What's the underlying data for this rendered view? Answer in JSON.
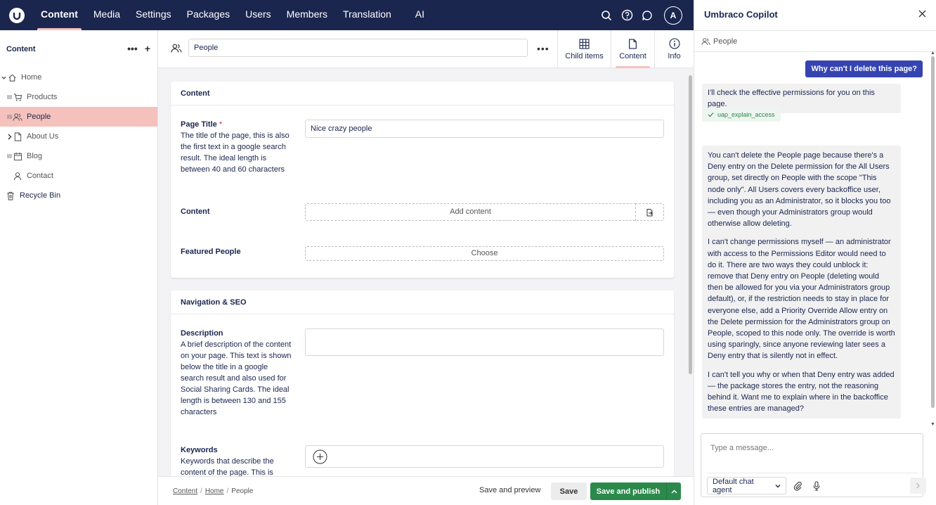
{
  "topnav": {
    "items": [
      {
        "label": "Content",
        "active": true
      },
      {
        "label": "Media"
      },
      {
        "label": "Settings"
      },
      {
        "label": "Packages"
      },
      {
        "label": "Users"
      },
      {
        "label": "Members"
      },
      {
        "label": "Translation"
      },
      {
        "label": "AI"
      }
    ],
    "avatar_initial": "A"
  },
  "sidebar": {
    "title": "Content",
    "tree": [
      {
        "label": "Home",
        "icon": "home-icon",
        "expanded": true
      },
      {
        "label": "Products",
        "icon": "cart-icon"
      },
      {
        "label": "People",
        "icon": "people-icon",
        "selected": true
      },
      {
        "label": "About Us",
        "icon": "document-icon",
        "collapsed": true
      },
      {
        "label": "Blog",
        "icon": "calendar-icon"
      },
      {
        "label": "Contact",
        "icon": "user-icon"
      },
      {
        "label": "Recycle Bin",
        "icon": "trash-icon"
      }
    ]
  },
  "editor": {
    "node_name": "People",
    "views": [
      {
        "label": "Child items",
        "icon": "grid-icon"
      },
      {
        "label": "Content",
        "icon": "document-icon",
        "active": true
      },
      {
        "label": "Info",
        "icon": "info-icon"
      }
    ],
    "groups": [
      {
        "title": "Content",
        "properties": [
          {
            "label": "Page Title",
            "required": "*",
            "description": "The title of the page, this is also the first text in a google search result. The ideal length is between 40 and 60 characters",
            "value": "Nice crazy people"
          },
          {
            "label": "Content",
            "button": "Add content"
          },
          {
            "label": "Featured People",
            "button": "Choose"
          }
        ]
      },
      {
        "title": "Navigation & SEO",
        "properties": [
          {
            "label": "Description",
            "description": "A brief description of the content on your page. This text is shown below the title in a google search result and also used for Social Sharing Cards. The ideal length is between 130 and 155 characters",
            "value": ""
          },
          {
            "label": "Keywords",
            "description": "Keywords that describe the content of the page. This is"
          }
        ]
      }
    ],
    "breadcrumb": [
      "Content",
      "Home",
      "People"
    ],
    "actions": {
      "preview": "Save and preview",
      "save": "Save",
      "publish": "Save and publish"
    }
  },
  "copilot": {
    "title": "Umbraco Copilot",
    "context": "People",
    "user_message": "Why can't I delete this page?",
    "assistant_intro": "I'll check the effective permissions for you on this page.",
    "tool_call": "uap_explain_access",
    "assistant_paragraphs": [
      "You can't delete the People page because there's a Deny entry on the Delete permission for the All Users group, set directly on People with the scope \"This node only\". All Users covers every backoffice user, including you as an Administrator, so it blocks you too — even though your Administrators group would otherwise allow deleting.",
      "I can't change permissions myself — an administrator with access to the Permissions Editor would need to do it. There are two ways they could unblock it: remove that Deny entry on People (deleting would then be allowed for you via your Administrators group default), or, if the restriction needs to stay in place for everyone else, add a Priority Override Allow entry on the Delete permission for the Administrators group on People, scoped to this node only. The override is worth using sparingly, since anyone reviewing later sees a Deny entry that is silently not in effect.",
      "I can't tell you why or when that Deny entry was added — the package stores the entry, not the reasoning behind it. Want me to explain where in the backoffice these entries are managed?"
    ],
    "input_placeholder": "Type a message...",
    "agent_select": "Default chat agent"
  },
  "colors": {
    "nav_bg": "#1b264f",
    "selected": "#f5c1bc",
    "publish": "#2b8a4b",
    "user_bubble": "#3544b1"
  }
}
